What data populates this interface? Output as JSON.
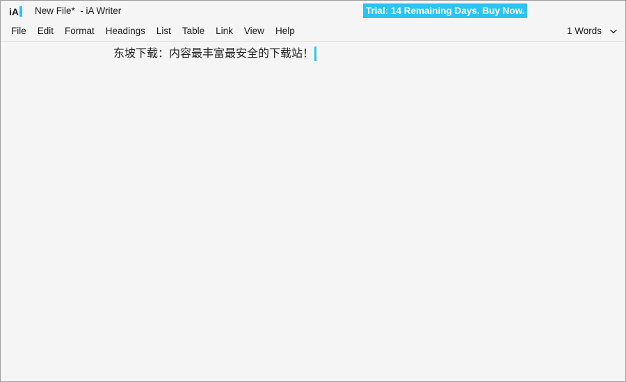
{
  "window": {
    "logo_text": "iA",
    "logo_caret_color": "#2ac4f4",
    "title": "New File*  - iA Writer"
  },
  "trial": {
    "text": "Trial: 14 Remaining Days. Buy Now.",
    "background_color": "#2ac4f4",
    "text_color": "#ffffff"
  },
  "menubar": {
    "items": [
      {
        "label": "File"
      },
      {
        "label": "Edit"
      },
      {
        "label": "Format"
      },
      {
        "label": "Headings"
      },
      {
        "label": "List"
      },
      {
        "label": "Table"
      },
      {
        "label": "Link"
      },
      {
        "label": "View"
      },
      {
        "label": "Help"
      }
    ],
    "wordcount": {
      "label": "1 Words",
      "chevron_icon": "chevron-down-icon"
    }
  },
  "editor": {
    "document_text": "东坡下载：内容最丰富最安全的下载站！",
    "caret_color": "#2ac4f4",
    "background_color": "#f5f5f5",
    "text_color": "#242424"
  }
}
